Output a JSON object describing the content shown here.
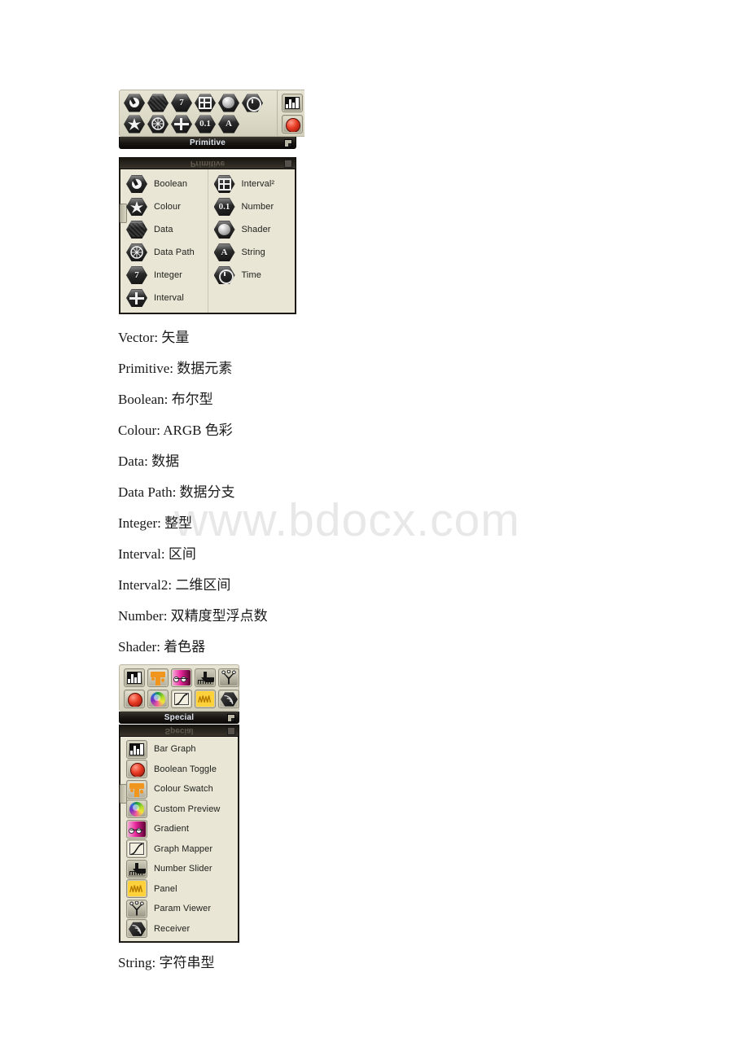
{
  "page": {
    "watermark": "www.bdocx.com",
    "background": "#ffffff"
  },
  "primitive_panel": {
    "caption": "Primitive",
    "caption_mirror": "Primitive",
    "toolbar_rows": [
      [
        {
          "name": "boolean-icon",
          "glyph": "◐"
        },
        {
          "name": "data-icon",
          "glyph": ""
        },
        {
          "name": "integer-icon",
          "glyph": "7"
        },
        {
          "name": "interval2-icon",
          "glyph": "⊞"
        },
        {
          "name": "shader-icon",
          "glyph": ""
        },
        {
          "name": "time-icon",
          "glyph": "◴"
        }
      ],
      [
        {
          "name": "colour-icon",
          "glyph": "✸"
        },
        {
          "name": "data-path-icon",
          "glyph": "☸"
        },
        {
          "name": "interval-icon",
          "glyph": "⊕"
        },
        {
          "name": "number-icon",
          "glyph": "0.1"
        },
        {
          "name": "string-icon",
          "glyph": "A"
        }
      ]
    ],
    "columns": [
      [
        {
          "label": "Boolean",
          "icon": "boolean-icon",
          "glyph": "◐"
        },
        {
          "label": "Colour",
          "icon": "colour-icon",
          "glyph": "✸"
        },
        {
          "label": "Data",
          "icon": "data-icon",
          "glyph": ""
        },
        {
          "label": "Data Path",
          "icon": "data-path-icon",
          "glyph": "☸"
        },
        {
          "label": "Integer",
          "icon": "integer-icon",
          "glyph": "7"
        },
        {
          "label": "Interval",
          "icon": "interval-icon",
          "glyph": "⊕"
        }
      ],
      [
        {
          "label": "Interval²",
          "icon": "interval2-icon",
          "glyph": "⊞"
        },
        {
          "label": "Number",
          "icon": "number-icon",
          "glyph": "0.1"
        },
        {
          "label": "Shader",
          "icon": "shader-icon",
          "glyph": ""
        },
        {
          "label": "String",
          "icon": "string-icon",
          "glyph": "A"
        },
        {
          "label": "Time",
          "icon": "time-icon",
          "glyph": "◴"
        }
      ]
    ]
  },
  "glossary": [
    "Vector: 矢量",
    "Primitive: 数据元素",
    "Boolean: 布尔型",
    "Colour: ARGB 色彩",
    "Data: 数据",
    "Data Path: 数据分支",
    "Integer: 整型",
    "Interval: 区间",
    "Interval2: 二维区间",
    "Number: 双精度型浮点数",
    "Shader: 着色器"
  ],
  "special_panel": {
    "caption": "Special",
    "caption_mirror": "Special",
    "toolbar_rows": [
      [
        "bar-graph-icon",
        "colour-swatch-icon",
        "gradient-icon",
        "number-slider-icon",
        "param-viewer-icon"
      ],
      [
        "boolean-toggle-icon",
        "custom-preview-icon",
        "graph-mapper-icon",
        "panel-icon",
        "receiver-icon"
      ]
    ],
    "items": [
      {
        "label": "Bar Graph",
        "icon": "bar-graph-icon"
      },
      {
        "label": "Boolean Toggle",
        "icon": "boolean-toggle-icon"
      },
      {
        "label": "Colour Swatch",
        "icon": "colour-swatch-icon"
      },
      {
        "label": "Custom Preview",
        "icon": "custom-preview-icon"
      },
      {
        "label": "Gradient",
        "icon": "gradient-icon"
      },
      {
        "label": "Graph Mapper",
        "icon": "graph-mapper-icon"
      },
      {
        "label": "Number Slider",
        "icon": "number-slider-icon"
      },
      {
        "label": "Panel",
        "icon": "panel-icon"
      },
      {
        "label": "Param Viewer",
        "icon": "param-viewer-icon"
      },
      {
        "label": "Receiver",
        "icon": "receiver-icon"
      }
    ]
  },
  "footer_line": "String: 字符串型"
}
